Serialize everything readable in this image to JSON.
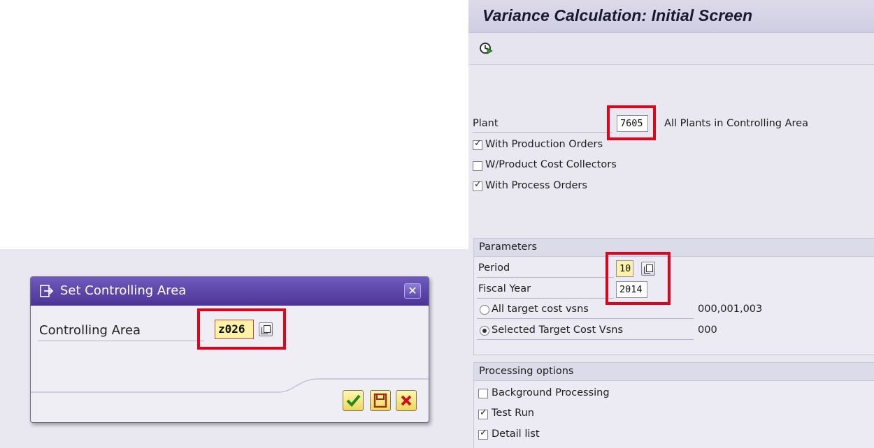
{
  "sap_screen": {
    "title": "Variance Calculation: Initial Screen",
    "toolbar": {
      "execute_icon": "execute-clock-icon"
    },
    "plant": {
      "label": "Plant",
      "value": "7605"
    },
    "all_plants_label": "All Plants in Controlling Area",
    "checkboxes": [
      {
        "label": "With Production Orders",
        "checked": true
      },
      {
        "label": "W/Product Cost Collectors",
        "checked": false
      },
      {
        "label": "With Process Orders",
        "checked": true
      }
    ],
    "parameters": {
      "header": "Parameters",
      "period": {
        "label": "Period",
        "value": "10"
      },
      "fiscal_year": {
        "label": "Fiscal Year",
        "value": "2014"
      },
      "radio_all": {
        "label": "All target cost vsns",
        "value": "000,001,003",
        "selected": false
      },
      "radio_selected": {
        "label": "Selected Target Cost Vsns",
        "value": "000",
        "selected": true
      }
    },
    "processing": {
      "header": "Processing options",
      "options": [
        {
          "label": "Background Processing",
          "checked": false
        },
        {
          "label": "Test Run",
          "checked": true
        },
        {
          "label": "Detail list",
          "checked": true
        }
      ]
    }
  },
  "dialog": {
    "title": "Set Controlling Area",
    "field_label": "Controlling Area",
    "field_value": "z026",
    "buttons": [
      "confirm-check-icon",
      "save-disk-icon",
      "cancel-x-icon"
    ]
  },
  "colors": {
    "highlight_red": "#e3001b",
    "dialog_title": "#4b3495",
    "input_yellow": "#fdf2a6"
  }
}
